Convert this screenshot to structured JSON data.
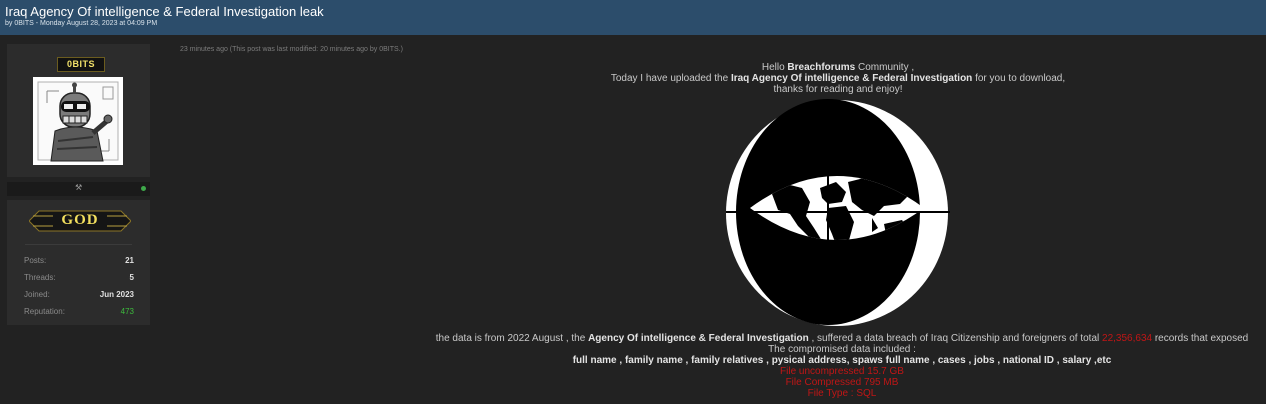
{
  "thread": {
    "title": "Iraq Agency Of intelligence & Federal Investigation leak",
    "byline": "by 0BITS - Monday August 28, 2023 at 04:09 PM"
  },
  "author": {
    "username": "0BITS",
    "status_icon": "crossed-tools-icon",
    "online_color": "#3ea84a",
    "rank_label": "GOD",
    "stats": [
      {
        "label": "Posts:",
        "value": "21"
      },
      {
        "label": "Threads:",
        "value": "5"
      },
      {
        "label": "Joined:",
        "value": "Jun 2023"
      },
      {
        "label": "Reputation:",
        "value": "473"
      }
    ]
  },
  "post": {
    "meta": "23 minutes ago  (This post was last modified: 20 minutes ago by 0BITS.)",
    "greeting_prefix": "Hello ",
    "community": "Breachforums",
    "greeting_suffix": " Community ,",
    "upload_prefix": "Today I have uploaded the ",
    "upload_name": "Iraq Agency Of intelligence & Federal Investigation",
    "upload_suffix": " for you to download,",
    "thanks": "thanks for reading and enjoy!",
    "data_prefix": "the data is from 2022 August , the ",
    "data_agency": "Agency Of intelligence & Federal Investigation",
    "data_mid": " , suffered a data breach of Iraq Citizenship and foreigners of total ",
    "record_count": "22,356,634",
    "data_suffix": " records that exposed",
    "compromised_heading": "The compromised data included :",
    "fields": "full name , family name , family relatives ,  pysical address, spaws full name , cases , jobs , national ID , salary ,etc",
    "file_uncompressed": "File uncompressed 15.7 GB",
    "file_compressed": "File Compressed 795 MB",
    "file_type": "File Type : SQL",
    "accent_red": "#c01616"
  }
}
